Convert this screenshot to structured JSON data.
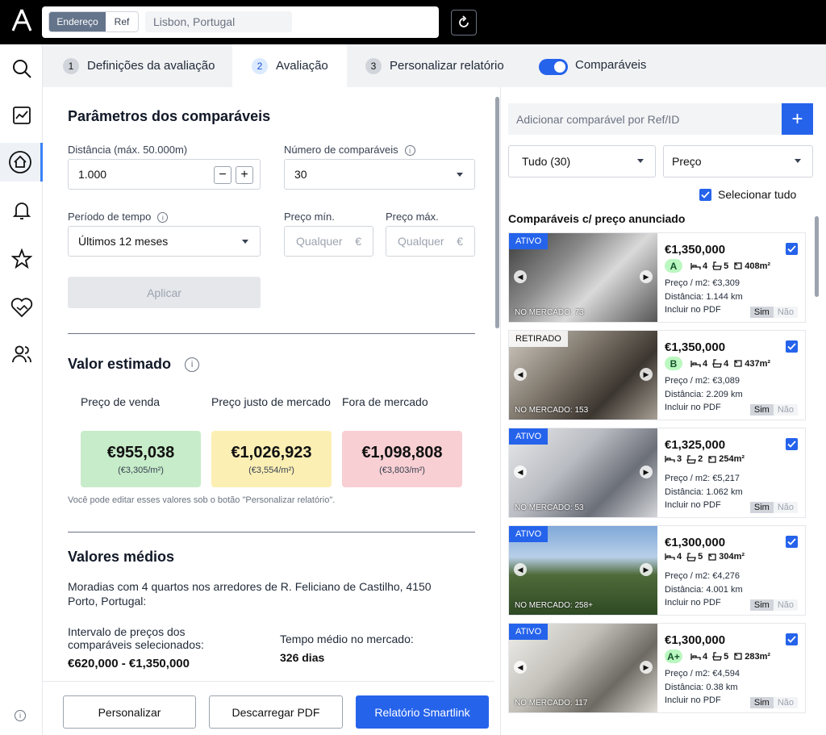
{
  "search": {
    "mode_address": "Endereço",
    "mode_ref": "Ref",
    "location_value": "Lisbon, Portugal"
  },
  "tabs": [
    {
      "num": "1",
      "label": "Definições da avaliação"
    },
    {
      "num": "2",
      "label": "Avaliação"
    },
    {
      "num": "3",
      "label": "Personalizar relatório"
    }
  ],
  "comparables_toggle": {
    "label": "Comparáveis",
    "on": true
  },
  "params": {
    "title": "Parâmetros dos comparáveis",
    "distance_label": "Distância (máx. 50.000m)",
    "distance_value": "1.000",
    "count_label": "Número de comparáveis",
    "count_value": "30",
    "period_label": "Período de tempo",
    "period_value": "Últimos 12 meses",
    "price_min_label": "Preço mín.",
    "price_max_label": "Preço máx.",
    "price_placeholder": "Qualquer",
    "currency": "€",
    "apply_label": "Aplicar"
  },
  "estimate": {
    "title": "Valor estimado",
    "cards": [
      {
        "label": "Preço de venda",
        "value": "€955,038",
        "per_m2": "(€3,305/m²)",
        "color": "#c7ecc9"
      },
      {
        "label": "Preço justo de mercado",
        "value": "€1,026,923",
        "per_m2": "(€3,554/m²)",
        "color": "#fcefb4"
      },
      {
        "label": "Fora de mercado",
        "value": "€1,098,808",
        "per_m2": "(€3,803/m²)",
        "color": "#f8cfd3"
      }
    ],
    "note": "Você pode editar esses valores sob o botão \"Personalizar relatório\"."
  },
  "averages": {
    "title": "Valores médios",
    "description": "Moradias com 4 quartos nos arredores de R. Feliciano de Castilho, 4150 Porto, Portugal:",
    "range_label": "Intervalo de preços dos comparáveis selecionados:",
    "range_value": "€620,000 - €1,350,000",
    "time_label": "Tempo médio no mercado:",
    "time_value": "326 dias"
  },
  "footer": {
    "customize": "Personalizar",
    "download": "Descarregar PDF",
    "smartlink": "Relatório Smartlink"
  },
  "right": {
    "add_placeholder": "Adicionar comparável por Ref/ID",
    "filter_value": "Tudo (30)",
    "sort_value": "Preço",
    "select_all": "Selecionar tudo",
    "list_title": "Comparáveis c/ preço anunciado",
    "price_m2_prefix": "Preço / m2: ",
    "distance_prefix": "Distância: ",
    "include_pdf": "Incluir no PDF",
    "yes": "Sim",
    "no": "Não",
    "comparables": [
      {
        "status": "ATIVO",
        "market": "NO MERCADO: 73",
        "price": "€1,350,000",
        "grade": "A",
        "grade_color": "#bbf7c0",
        "beds": "4",
        "baths": "5",
        "area": "408m²",
        "price_m2": "€3,309",
        "distance": "1.144 km"
      },
      {
        "status": "RETIRADO",
        "market": "NO MERCADO: 153",
        "price": "€1,350,000",
        "grade": "B",
        "grade_color": "#bbf7c0",
        "beds": "4",
        "baths": "4",
        "area": "437m²",
        "price_m2": "€3,089",
        "distance": "2.209 km"
      },
      {
        "status": "ATIVO",
        "market": "NO MERCADO: 53",
        "price": "€1,325,000",
        "grade": "",
        "grade_color": "",
        "beds": "3",
        "baths": "2",
        "area": "254m²",
        "price_m2": "€5,217",
        "distance": "1.062 km"
      },
      {
        "status": "ATIVO",
        "market": "NO MERCADO: 258+",
        "price": "€1,300,000",
        "grade": "",
        "grade_color": "",
        "beds": "4",
        "baths": "5",
        "area": "304m²",
        "price_m2": "€4,276",
        "distance": "4.001 km"
      },
      {
        "status": "ATIVO",
        "market": "NO MERCADO: 117",
        "price": "€1,300,000",
        "grade": "A+",
        "grade_color": "#bbf7c0",
        "beds": "4",
        "baths": "5",
        "area": "283m²",
        "price_m2": "€4,594",
        "distance": "0.38 km"
      }
    ]
  }
}
